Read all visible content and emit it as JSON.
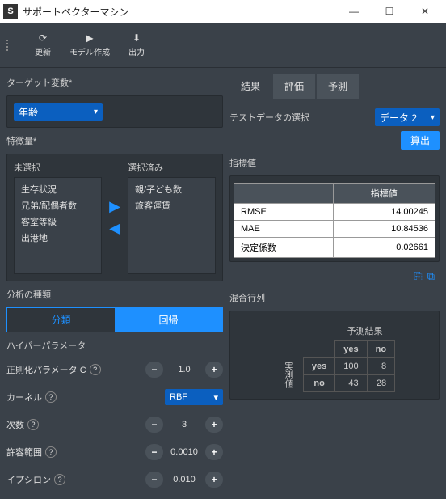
{
  "window": {
    "title": "サポートベクターマシン"
  },
  "toolbar": {
    "update": "更新",
    "model": "モデル作成",
    "output": "出力"
  },
  "left": {
    "target_label": "ターゲット変数*",
    "target_value": "年齢",
    "feature_label": "特徴量*",
    "unselected_label": "未選択",
    "selected_label": "選択済み",
    "unselected_items": [
      "生存状況",
      "兄弟/配偶者数",
      "客室等級",
      "出港地"
    ],
    "selected_items": [
      "親/子ども数",
      "旅客運賃"
    ],
    "analysis_type_label": "分析の種類",
    "seg_class": "分類",
    "seg_reg": "回帰",
    "hyper_label": "ハイパーパラメータ",
    "params": {
      "c_label": "正則化パラメータ C",
      "c_value": "1.0",
      "kernel_label": "カーネル",
      "kernel_value": "RBF",
      "degree_label": "次数",
      "degree_value": "3",
      "tol_label": "許容範囲",
      "tol_value": "0.0010",
      "eps_label": "イプシロン",
      "eps_value": "0.010"
    }
  },
  "right": {
    "tabs": {
      "result": "結果",
      "eval": "評価",
      "predict": "予測"
    },
    "testdata_label": "テストデータの選択",
    "testdata_value": "データ 2",
    "calc_btn": "算出",
    "metrics_label": "指標値",
    "metrics_header": "指標値",
    "metrics": {
      "rmse_label": "RMSE",
      "rmse_value": "14.00245",
      "mae_label": "MAE",
      "mae_value": "10.84536",
      "r2_label": "決定係数",
      "r2_value": "0.02661"
    },
    "cmatrix_label": "混合行列",
    "pred_label": "予測結果",
    "actual_label": "実測値",
    "yes": "yes",
    "no": "no",
    "cm": {
      "yy": "100",
      "yn": "8",
      "ny": "43",
      "nn": "28"
    }
  }
}
